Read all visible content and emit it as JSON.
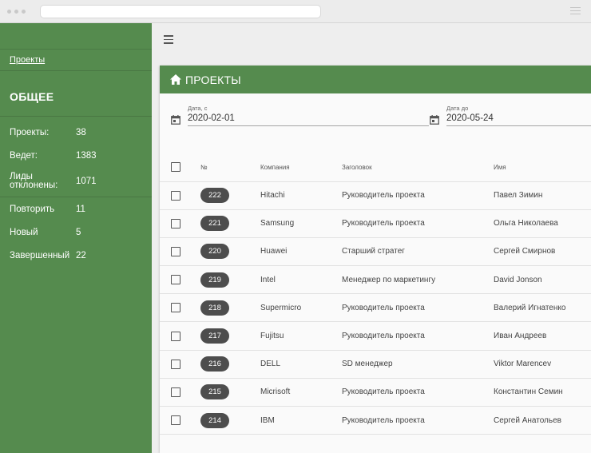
{
  "sidebar": {
    "link": "Проекты",
    "heading": "ОБЩЕЕ",
    "stats": [
      {
        "label": "Проекты:",
        "value": "38"
      },
      {
        "label": "Ведет:",
        "value": "1383"
      },
      {
        "label": "Лиды отклонены:",
        "value": "1071"
      },
      {
        "label": "Повторить",
        "value": "11"
      },
      {
        "label": "Новый",
        "value": "5"
      },
      {
        "label": "Завершенный",
        "value": "22"
      }
    ]
  },
  "card": {
    "title": "ПРОЕКТЫ",
    "date_from": {
      "label": "Дата, с",
      "value": "2020-02-01"
    },
    "date_to": {
      "label": "Дата до",
      "value": "2020-05-24"
    }
  },
  "table": {
    "headers": {
      "num": "№",
      "company": "Компания",
      "title": "Заголовок",
      "name": "Имя"
    },
    "rows": [
      {
        "num": "222",
        "company": "Hitachi",
        "title": "Руководитель проекта",
        "name": "Павел Зимин"
      },
      {
        "num": "221",
        "company": "Samsung",
        "title": "Руководитель проекта",
        "name": "Ольга Николаева"
      },
      {
        "num": "220",
        "company": "Huawei",
        "title": "Старший стратег",
        "name": "Сергей Смирнов"
      },
      {
        "num": "219",
        "company": "Intel",
        "title": "Менеджер по маркетингу",
        "name": "David Jonson"
      },
      {
        "num": "218",
        "company": "Supermicro",
        "title": "Руководитель проекта",
        "name": "Валерий Игнатенко"
      },
      {
        "num": "217",
        "company": "Fujitsu",
        "title": "Руководитель проекта",
        "name": "Иван Андреев"
      },
      {
        "num": "216",
        "company": "DELL",
        "title": "SD менеджер",
        "name": "Viktor Marencev"
      },
      {
        "num": "215",
        "company": "Micrisoft",
        "title": "Руководитель проекта",
        "name": "Константин Семин"
      },
      {
        "num": "214",
        "company": "IBM",
        "title": "Руководитель проекта",
        "name": "Сергей Анатольев"
      }
    ]
  },
  "colors": {
    "brand_green": "#558b4e",
    "badge": "#4d4d4d"
  },
  "icons": {
    "home": "home-icon",
    "calendar": "calendar-icon",
    "menu": "hamburger-icon"
  }
}
